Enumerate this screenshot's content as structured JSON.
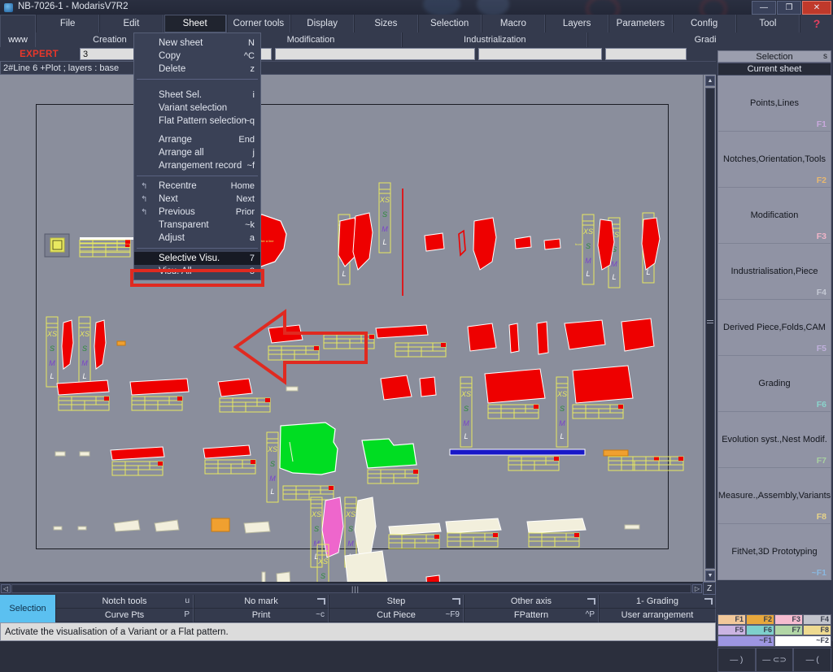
{
  "titlebar": {
    "title": "NB-7026-1  - ModarisV7R2",
    "minimize": "—",
    "maximize": "❐",
    "close": "✕",
    "app_icon": "modaris-app-icon"
  },
  "menubar": {
    "www_label": "www",
    "items": [
      {
        "label": "File",
        "active": false
      },
      {
        "label": "Edit",
        "active": false
      },
      {
        "label": "Sheet",
        "active": true
      },
      {
        "label": "Corner tools",
        "active": false
      },
      {
        "label": "Display",
        "active": false
      },
      {
        "label": "Sizes",
        "active": false
      },
      {
        "label": "Selection",
        "active": false
      },
      {
        "label": "Macro",
        "active": false
      },
      {
        "label": "Layers",
        "active": false
      },
      {
        "label": "Parameters",
        "active": false
      },
      {
        "label": "Config",
        "active": false
      },
      {
        "label": "Tool",
        "active": false
      }
    ],
    "help_glyph": "?"
  },
  "bands": {
    "row1": [
      "Creation",
      "Modification",
      "Industrialization",
      "Grading"
    ],
    "expert_label": "EXPERT",
    "size_value": "3",
    "layers_text": "2#Line 6 +Plot   ;    layers :  base"
  },
  "dropdown": {
    "rows": [
      {
        "label": "New sheet",
        "accel": "N",
        "arrow": "",
        "selected": false
      },
      {
        "label": "Copy",
        "accel": "^C",
        "arrow": "",
        "selected": false
      },
      {
        "label": "Delete",
        "accel": "z",
        "arrow": "",
        "selected": false
      },
      {
        "sep": true
      },
      {
        "gap": true
      },
      {
        "label": "Sheet Sel.",
        "accel": "i",
        "arrow": "",
        "selected": false
      },
      {
        "label": "Variant selection",
        "accel": "",
        "arrow": "",
        "selected": false
      },
      {
        "label": "Flat Pattern selection",
        "accel": "~q",
        "arrow": "",
        "selected": false
      },
      {
        "gap": true
      },
      {
        "label": "Arrange",
        "accel": "End",
        "arrow": "",
        "selected": false
      },
      {
        "label": "Arrange all",
        "accel": "j",
        "arrow": "",
        "selected": false
      },
      {
        "label": "Arrangement record",
        "accel": "~f",
        "arrow": "",
        "selected": false
      },
      {
        "sep": true
      },
      {
        "label": "Recentre",
        "accel": "Home",
        "arrow": "↰",
        "selected": false
      },
      {
        "label": "Next",
        "accel": "Next",
        "arrow": "↰",
        "selected": false
      },
      {
        "label": "Previous",
        "accel": "Prior",
        "arrow": "↰",
        "selected": false
      },
      {
        "label": "Transparent",
        "accel": "~k",
        "arrow": "",
        "selected": false
      },
      {
        "label": "Adjust",
        "accel": "a",
        "arrow": "",
        "selected": false
      },
      {
        "sep": true
      },
      {
        "label": "Selective Visu.",
        "accel": "7",
        "arrow": "",
        "selected": true
      },
      {
        "label": "Visu. All",
        "accel": "8",
        "arrow": "",
        "selected": false
      }
    ],
    "highlight_color": "#e02a20"
  },
  "right_panel": {
    "selection_label": "Selection",
    "selection_key": "s",
    "current_sheet_label": "Current sheet",
    "buttons": [
      {
        "label": "Points,Lines",
        "fkey": "F1",
        "fcolor": "#c8a8dc"
      },
      {
        "label": "Notches,Orientation,Tools",
        "fkey": "F2",
        "fcolor": "#e8b870"
      },
      {
        "label": "Modification",
        "fkey": "F3",
        "fcolor": "#f0b4c8"
      },
      {
        "label": "Industrialisation,Piece",
        "fkey": "F4",
        "fcolor": "#c4c8d4"
      },
      {
        "label": "Derived Piece,Folds,CAM",
        "fkey": "F5",
        "fcolor": "#c0b0dc"
      },
      {
        "label": "Grading",
        "fkey": "F6",
        "fcolor": "#8ad4cc"
      },
      {
        "label": "Evolution syst.,Nest Modif.",
        "fkey": "F7",
        "fcolor": "#a8d0a0"
      },
      {
        "label": "Measure.,Assembly,Variants",
        "fkey": "F8",
        "fcolor": "#e8d488"
      },
      {
        "label": "FitNet,3D Prototyping",
        "fkey": "~F1",
        "fcolor": "#8ab8e0"
      }
    ],
    "swatches_row1": [
      {
        "key": "F1",
        "color": "#f2c89a"
      },
      {
        "key": "F2",
        "color": "#e8a83c"
      },
      {
        "key": "F3",
        "color": "#f6bcd0"
      },
      {
        "key": "F4",
        "color": "#c2c4cc"
      }
    ],
    "swatches_row2": [
      {
        "key": "F5",
        "color": "#cbb4e2"
      },
      {
        "key": "F6",
        "color": "#7ed0cc"
      },
      {
        "key": "F7",
        "color": "#b2d6a6"
      },
      {
        "key": "F8",
        "color": "#eeda90"
      }
    ],
    "swatches_row3": [
      {
        "key": "~F1",
        "color": "#9d96e2"
      },
      {
        "key": "~F2",
        "color": "#ffffff"
      }
    ],
    "tail_cells": [
      "—  )",
      "—  ⊂⊃",
      "—  ("
    ]
  },
  "bottom_toolbar": {
    "selection_label": "Selection",
    "row1": [
      {
        "label": "Notch tools",
        "key": "u",
        "corner": false
      },
      {
        "label": "No mark",
        "key": "",
        "corner": true
      },
      {
        "label": "Step",
        "key": "",
        "corner": true
      },
      {
        "label": "Other axis",
        "key": "",
        "corner": true
      },
      {
        "label": "1- Grading",
        "key": "",
        "corner": true
      }
    ],
    "row2": [
      {
        "label": "Curve Pts",
        "key": "P",
        "corner": false
      },
      {
        "label": "Print",
        "key": "~c",
        "corner": false
      },
      {
        "label": "Cut Piece",
        "key": "~F9",
        "corner": false
      },
      {
        "label": "FPattern",
        "key": "^P",
        "corner": false
      },
      {
        "label": "User arrangement",
        "key": "",
        "corner": false
      }
    ]
  },
  "statusbar": {
    "text": "Activate the visualisation of a Variant or a Flat pattern."
  },
  "scrollbars": {
    "v_up": "▲",
    "v_down": "▼",
    "h_left": "◁",
    "h_right": "▷",
    "z_label": "Z",
    "h_grip": "|||"
  },
  "canvas": {
    "background": "#8a8e9c",
    "sheet_border": "#1a1c24",
    "size_labels": [
      "XS",
      "S",
      "M",
      "L"
    ],
    "piece_colors": {
      "red": "#ee0000",
      "green": "#00dd22",
      "magenta": "#ee66cc",
      "cream": "#f2efdc",
      "blue": "#1818c8",
      "orange": "#f0a030",
      "yellow_outline": "#e8e860",
      "white_outline": "#ffffff"
    },
    "annotation_arrow_color": "#e02a20"
  }
}
